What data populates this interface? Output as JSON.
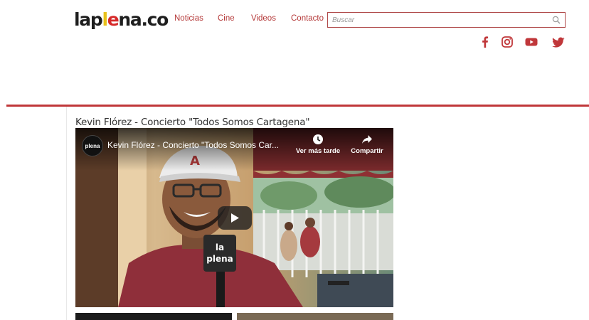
{
  "logo": {
    "part1": "lap",
    "part2": "l",
    "part3": "e",
    "part4": "na.co"
  },
  "nav": {
    "items": [
      {
        "label": "Noticias"
      },
      {
        "label": "Cine"
      },
      {
        "label": "Videos"
      },
      {
        "label": "Contacto"
      }
    ]
  },
  "search": {
    "placeholder": "Buscar"
  },
  "social": [
    "facebook-icon",
    "instagram-icon",
    "youtube-icon",
    "twitter-icon"
  ],
  "colors": {
    "accent": "#c0373a",
    "nav": "#b53a3a",
    "brand_yellow": "#e8c11a"
  },
  "article": {
    "title": "Kevin Flórez - Concierto \"Todos Somos Cartagena\""
  },
  "video": {
    "title": "Kevin Flórez - Concierto \"Todos Somos Car...",
    "watch_later": "Ver más tarde",
    "share": "Compartir",
    "channel_badge": "plena",
    "mic_top": "la",
    "mic_bottom": "plena",
    "hat_letter": "A"
  }
}
